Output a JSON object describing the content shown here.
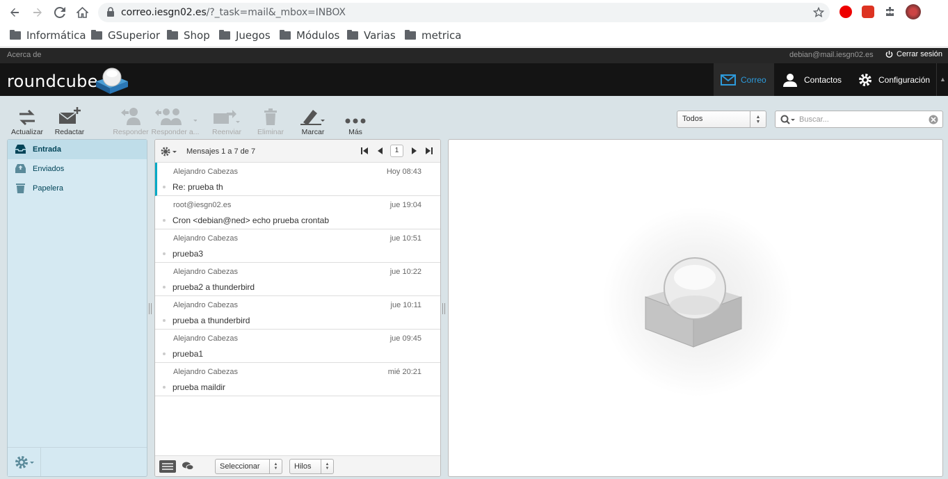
{
  "browser": {
    "url_host": "correo.iesgn02.es",
    "url_path": "/?_task=mail&_mbox=INBOX",
    "bookmarks": [
      "Informática",
      "GSuperior",
      "Shop",
      "Juegos",
      "Módulos",
      "Varias",
      "metrica"
    ]
  },
  "topline": {
    "about": "Acerca de",
    "user": "debian@mail.iesgn02.es",
    "logout": "Cerrar sesión"
  },
  "header": {
    "logo": "roundcube",
    "tasks": [
      "Correo",
      "Contactos",
      "Configuración"
    ]
  },
  "toolbar": {
    "refresh": "Actualizar",
    "compose": "Redactar",
    "reply": "Responder",
    "reply_all": "Responder a...",
    "forward": "Reenviar",
    "delete": "Eliminar",
    "mark": "Marcar",
    "more": "Más",
    "filter_value": "Todos",
    "search_placeholder": "Buscar..."
  },
  "folders": [
    {
      "label": "Entrada",
      "icon": "inbox-icon",
      "selected": true
    },
    {
      "label": "Enviados",
      "icon": "sent-icon",
      "selected": false
    },
    {
      "label": "Papelera",
      "icon": "trash-icon",
      "selected": false
    }
  ],
  "messagelist": {
    "count_text": "Mensajes 1 a 7 de 7",
    "page": "1",
    "select_label": "Seleccionar",
    "threads_label": "Hilos",
    "messages": [
      {
        "from": "Alejandro Cabezas",
        "date": "Hoy 08:43",
        "subject": "Re: prueba th"
      },
      {
        "from": "root@iesgn02.es",
        "date": "jue 19:04",
        "subject": "Cron <debian@ned> echo prueba crontab"
      },
      {
        "from": "Alejandro Cabezas",
        "date": "jue 10:51",
        "subject": "prueba3"
      },
      {
        "from": "Alejandro Cabezas",
        "date": "jue 10:22",
        "subject": "prueba2 a thunderbird"
      },
      {
        "from": "Alejandro Cabezas",
        "date": "jue 10:11",
        "subject": "prueba a thunderbird"
      },
      {
        "from": "Alejandro Cabezas",
        "date": "jue 09:45",
        "subject": "prueba1"
      },
      {
        "from": "Alejandro Cabezas",
        "date": "mié 20:21",
        "subject": "prueba maildir"
      }
    ]
  },
  "colors": {
    "accent": "#2d9bdc",
    "selected_folder": "#bfdde9",
    "unread_bar": "#00aac6"
  }
}
